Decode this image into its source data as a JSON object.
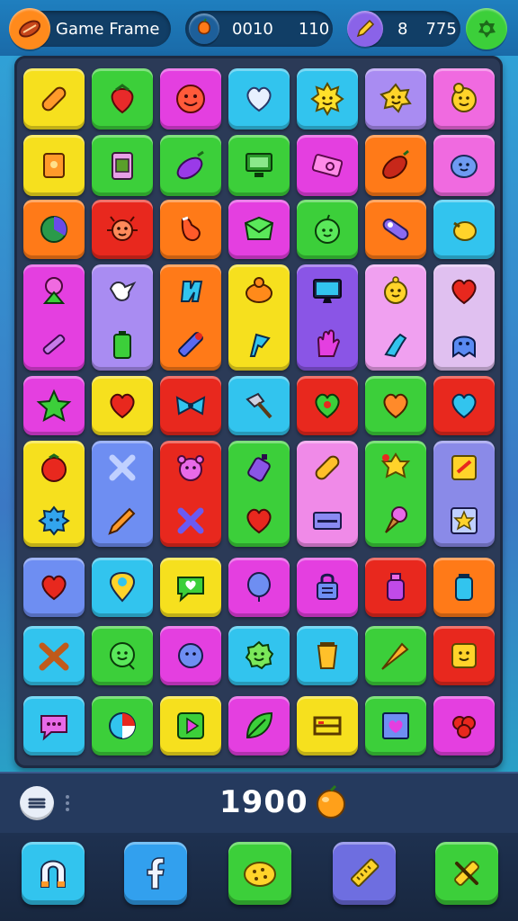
{
  "header": {
    "title": "Game Frame",
    "counter_a": "0010",
    "counter_b": "110",
    "counter_c": "8",
    "counter_d": "775"
  },
  "colors": {
    "yellow": "#f6e01e",
    "green": "#3ccf3a",
    "magenta": "#e43fe0",
    "cyan": "#32c4ee",
    "lavender": "#a98cf2",
    "pink": "#f06ae0",
    "orange": "#ff7a18",
    "red": "#e8281e",
    "violet": "#8a55e6",
    "blue": "#6e8ef2"
  },
  "score": {
    "value": "1900"
  }
}
